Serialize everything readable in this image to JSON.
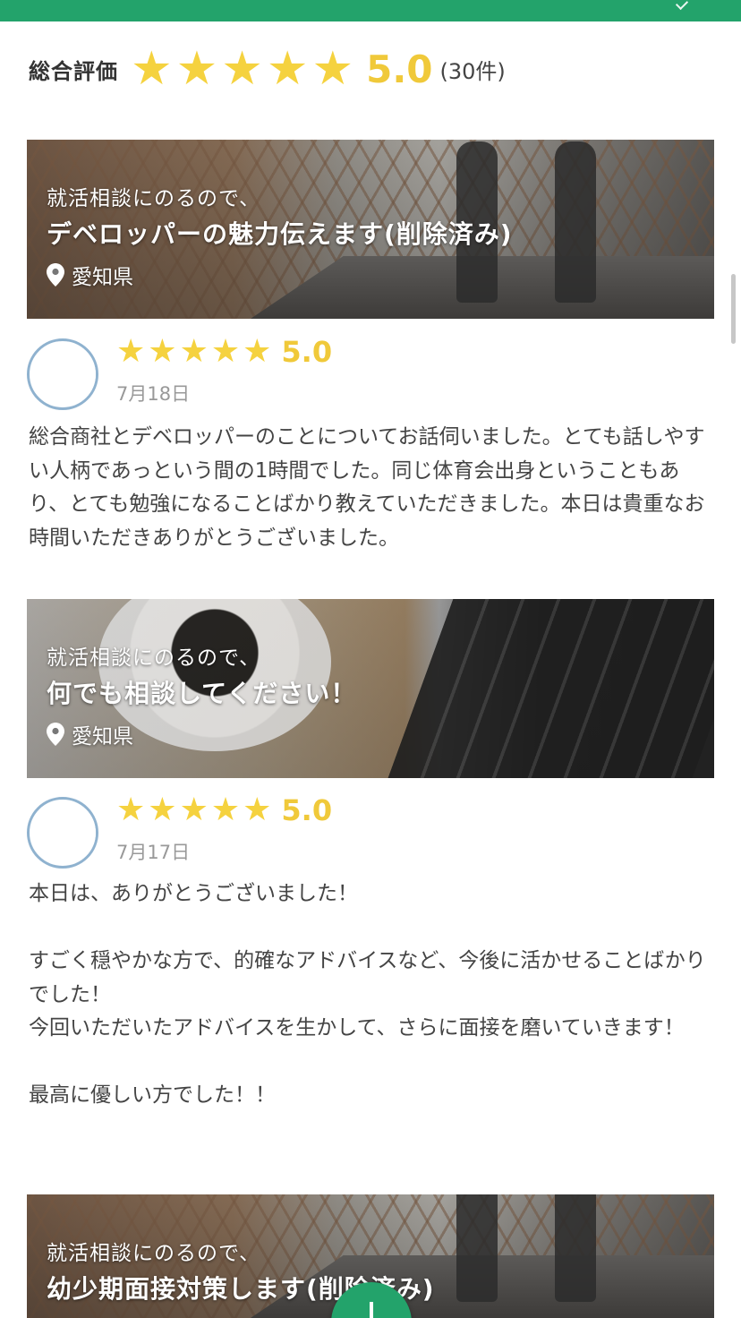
{
  "overall": {
    "label": "総合評価",
    "stars": [
      "★",
      "★",
      "★",
      "★",
      "★"
    ],
    "score": "5.0",
    "count": "(30件)"
  },
  "banners": [
    {
      "subtitle": "就活相談にのるので、",
      "title": "デベロッパーの魅力伝えます(削除済み)",
      "location": "愛知県"
    },
    {
      "subtitle": "就活相談にのるので、",
      "title": "何でも相談してください！",
      "location": "愛知県"
    },
    {
      "subtitle": "就活相談にのるので、",
      "title": "幼少期面接対策します(削除済み)"
    }
  ],
  "reviews": [
    {
      "stars": [
        "★",
        "★",
        "★",
        "★",
        "★"
      ],
      "score": "5.0",
      "date": "7月18日",
      "body": "総合商社とデベロッパーのことについてお話伺いました。とても話しやすい人柄であっという間の1時間でした。同じ体育会出身ということもあり、とても勉強になることばかり教えていただきました。本日は貴重なお時間いただきありがとうございました。"
    },
    {
      "stars": [
        "★",
        "★",
        "★",
        "★",
        "★"
      ],
      "score": "5.0",
      "date": "7月17日",
      "body": "本日は、ありがとうございました！\n\nすごく穏やかな方で、的確なアドバイスなど、今後に活かせることばかりでした！\n今回いただいたアドバイスを生かして、さらに面接を磨いていきます！\n\n最高に優しい方でした！！"
    }
  ],
  "icons": {
    "location": "location-pin-icon",
    "star": "star-icon",
    "fab": "plus-icon"
  },
  "colors": {
    "header": "#23a36b",
    "star": "#f5d23f",
    "score": "#f0c93a"
  }
}
